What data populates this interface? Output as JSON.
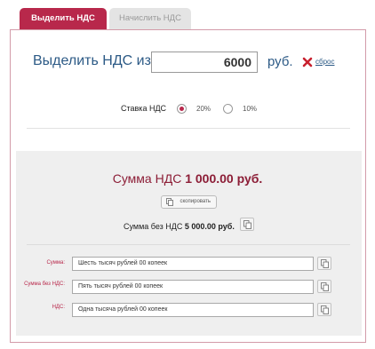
{
  "tabs": [
    {
      "label": "Выделить НДС",
      "active": true
    },
    {
      "label": "Начислить НДС",
      "active": false
    }
  ],
  "form": {
    "title": "Выделить НДС из",
    "amount_value": "6000",
    "currency": "руб.",
    "reset_label": "сброс",
    "rate_label": "Ставка НДС",
    "rates": [
      {
        "label": "20%",
        "selected": true
      },
      {
        "label": "10%",
        "selected": false
      }
    ]
  },
  "result": {
    "vat_label": "Сумма НДС",
    "vat_value": "1 000.00 руб.",
    "copy_label": "скопировать",
    "without_label": "Сумма без НДС",
    "without_value": "5 000.00 руб."
  },
  "words": [
    {
      "label": "Сумма:",
      "value": "Шесть тысяч рублей 00 копеек"
    },
    {
      "label": "Сумма без НДС:",
      "value": "Пять тысяч рублей 00 копеек"
    },
    {
      "label": "НДС:",
      "value": "Одна тысяча рублей 00 копеек"
    }
  ],
  "colors": {
    "accent": "#b8284b",
    "title_blue": "#2c5a86",
    "result_bg": "#efefef"
  },
  "icons": [
    "close-icon",
    "copy-icon"
  ]
}
